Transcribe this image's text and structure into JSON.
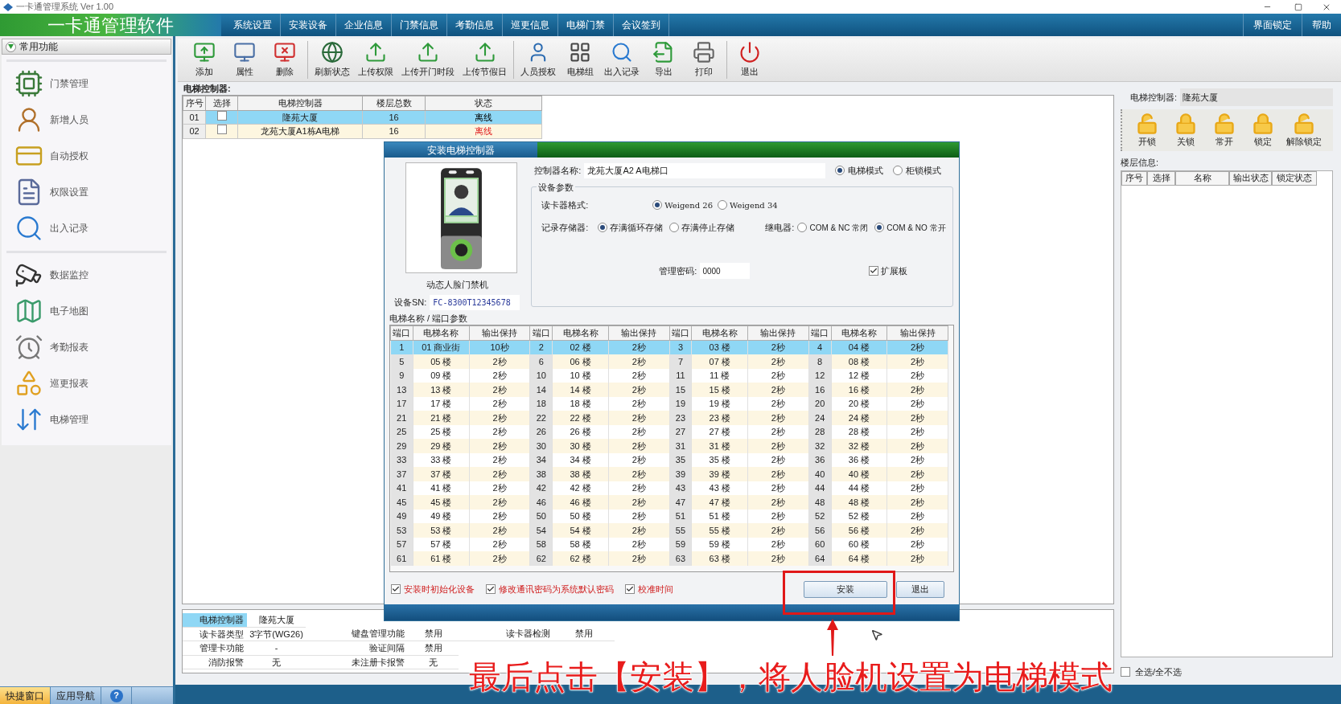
{
  "window": {
    "title": "一卡通管理系统 Ver 1.00"
  },
  "header": {
    "logo": "一卡通管理软件",
    "menu": [
      "系统设置",
      "安装设备",
      "企业信息",
      "门禁信息",
      "考勤信息",
      "巡更信息",
      "电梯门禁",
      "会议签到"
    ],
    "right_menu": [
      "界面锁定",
      "帮助"
    ]
  },
  "sidebar": {
    "title": "常用功能",
    "groups": [
      [
        "门禁管理",
        "新增人员",
        "自动授权",
        "权限设置",
        "出入记录"
      ],
      [
        "数据监控",
        "电子地图",
        "考勤报表",
        "巡更报表",
        "电梯管理"
      ]
    ]
  },
  "bottom_tabs": [
    {
      "label": "快捷窗口",
      "selected": true
    },
    {
      "label": "应用导航",
      "selected": false
    },
    {
      "label": "?",
      "selected": false
    }
  ],
  "toolbar": {
    "groups": [
      [
        "添加",
        "属性",
        "删除"
      ],
      [
        "刷新状态",
        "上传权限",
        "上传开门时段",
        "上传节假日"
      ],
      [
        "人员授权",
        "电梯组",
        "出入记录",
        "导出",
        "打印"
      ],
      [
        "退出"
      ]
    ]
  },
  "controllers": {
    "label": "电梯控制器:",
    "columns": [
      "序号",
      "选择",
      "电梯控制器",
      "楼层总数",
      "状态"
    ],
    "rows": [
      {
        "no": "01",
        "checked": false,
        "name": "隆苑大厦",
        "floors": "16",
        "status": "离线",
        "alert": false,
        "selected": true
      },
      {
        "no": "02",
        "checked": false,
        "name": "龙苑大厦A1栋A电梯",
        "floors": "16",
        "status": "离线",
        "alert": true,
        "selected": false
      }
    ]
  },
  "info_table": [
    [
      "电梯控制器",
      "隆苑大厦"
    ],
    [
      "读卡器类型",
      "3字节(WG26)",
      "键盘管理功能",
      "禁用",
      "读卡器检测",
      "禁用"
    ],
    [
      "管理卡功能",
      "-",
      "验证间隔",
      "禁用"
    ],
    [
      "消防报警",
      "无",
      "未注册卡报警",
      "无"
    ]
  ],
  "right_panel": {
    "controller_label": "电梯控制器:",
    "controller_value": "隆苑大厦",
    "actions": [
      {
        "label": "开锁",
        "kind": "open"
      },
      {
        "label": "关锁",
        "kind": "closed"
      },
      {
        "label": "常开",
        "kind": "open"
      },
      {
        "label": "锁定",
        "kind": "closed"
      },
      {
        "label": "解除锁定",
        "kind": "open"
      }
    ],
    "floor_label": "楼层信息:",
    "columns": [
      "序号",
      "选择",
      "名称",
      "输出状态",
      "锁定状态"
    ],
    "select_all": {
      "label": "全选/全不选",
      "checked": false
    }
  },
  "dialog": {
    "title": "安装电梯控制器",
    "device_name": "动态人脸门禁机",
    "sn_label": "设备SN:",
    "sn": "FC-8300T12345678",
    "name_label": "控制器名称:",
    "name_value": "龙苑大厦A2 A电梯口",
    "modes": [
      {
        "label": "电梯模式",
        "selected": true
      },
      {
        "label": "柜锁模式",
        "selected": false
      }
    ],
    "params_title": "设备参数",
    "reader_label": "读卡器格式:",
    "reader_options": [
      {
        "label": "Weigend 26",
        "selected": true
      },
      {
        "label": "Weigend 34",
        "selected": false
      }
    ],
    "storage_label": "记录存储器:",
    "storage_options": [
      {
        "label": "存满循环存储",
        "selected": true
      },
      {
        "label": "存满停止存储",
        "selected": false
      }
    ],
    "relay_label": "继电器:",
    "relay_options": [
      {
        "label": "COM & NC 常闭",
        "selected": false
      },
      {
        "label": "COM & NO 常开",
        "selected": true
      }
    ],
    "password_label": "管理密码:",
    "password": "0000",
    "expansion": {
      "label": "扩展板",
      "checked": true
    },
    "ports_title": "电梯名称 / 端口参数",
    "port_columns": [
      "端口",
      "电梯名称",
      "输出保持",
      "端口",
      "电梯名称",
      "输出保持",
      "端口",
      "电梯名称",
      "输出保持",
      "端口",
      "电梯名称",
      "输出保持"
    ],
    "port_rows": [
      {
        "selected": true,
        "cells": [
          {
            "port": "1",
            "name": "01 商业街",
            "hold": "10秒"
          },
          {
            "port": "2",
            "name": "02 楼",
            "hold": "2秒"
          },
          {
            "port": "3",
            "name": "03 楼",
            "hold": "2秒"
          },
          {
            "port": "4",
            "name": "04 楼",
            "hold": "2秒"
          }
        ]
      },
      {
        "selected": false,
        "cells": [
          {
            "port": "5",
            "name": "05 楼",
            "hold": "2秒"
          },
          {
            "port": "6",
            "name": "06 楼",
            "hold": "2秒"
          },
          {
            "port": "7",
            "name": "07 楼",
            "hold": "2秒"
          },
          {
            "port": "8",
            "name": "08 楼",
            "hold": "2秒"
          }
        ]
      },
      {
        "selected": false,
        "cells": [
          {
            "port": "9",
            "name": "09 楼",
            "hold": "2秒"
          },
          {
            "port": "10",
            "name": "10 楼",
            "hold": "2秒"
          },
          {
            "port": "11",
            "name": "11 楼",
            "hold": "2秒"
          },
          {
            "port": "12",
            "name": "12 楼",
            "hold": "2秒"
          }
        ]
      },
      {
        "selected": false,
        "cells": [
          {
            "port": "13",
            "name": "13 楼",
            "hold": "2秒"
          },
          {
            "port": "14",
            "name": "14 楼",
            "hold": "2秒"
          },
          {
            "port": "15",
            "name": "15 楼",
            "hold": "2秒"
          },
          {
            "port": "16",
            "name": "16 楼",
            "hold": "2秒"
          }
        ]
      },
      {
        "selected": false,
        "cells": [
          {
            "port": "17",
            "name": "17 楼",
            "hold": "2秒"
          },
          {
            "port": "18",
            "name": "18 楼",
            "hold": "2秒"
          },
          {
            "port": "19",
            "name": "19 楼",
            "hold": "2秒"
          },
          {
            "port": "20",
            "name": "20 楼",
            "hold": "2秒"
          }
        ]
      },
      {
        "selected": false,
        "cells": [
          {
            "port": "21",
            "name": "21 楼",
            "hold": "2秒"
          },
          {
            "port": "22",
            "name": "22 楼",
            "hold": "2秒"
          },
          {
            "port": "23",
            "name": "23 楼",
            "hold": "2秒"
          },
          {
            "port": "24",
            "name": "24 楼",
            "hold": "2秒"
          }
        ]
      },
      {
        "selected": false,
        "cells": [
          {
            "port": "25",
            "name": "25 楼",
            "hold": "2秒"
          },
          {
            "port": "26",
            "name": "26 楼",
            "hold": "2秒"
          },
          {
            "port": "27",
            "name": "27 楼",
            "hold": "2秒"
          },
          {
            "port": "28",
            "name": "28 楼",
            "hold": "2秒"
          }
        ]
      },
      {
        "selected": false,
        "cells": [
          {
            "port": "29",
            "name": "29 楼",
            "hold": "2秒"
          },
          {
            "port": "30",
            "name": "30 楼",
            "hold": "2秒"
          },
          {
            "port": "31",
            "name": "31 楼",
            "hold": "2秒"
          },
          {
            "port": "32",
            "name": "32 楼",
            "hold": "2秒"
          }
        ]
      },
      {
        "selected": false,
        "cells": [
          {
            "port": "33",
            "name": "33 楼",
            "hold": "2秒"
          },
          {
            "port": "34",
            "name": "34 楼",
            "hold": "2秒"
          },
          {
            "port": "35",
            "name": "35 楼",
            "hold": "2秒"
          },
          {
            "port": "36",
            "name": "36 楼",
            "hold": "2秒"
          }
        ]
      },
      {
        "selected": false,
        "cells": [
          {
            "port": "37",
            "name": "37 楼",
            "hold": "2秒"
          },
          {
            "port": "38",
            "name": "38 楼",
            "hold": "2秒"
          },
          {
            "port": "39",
            "name": "39 楼",
            "hold": "2秒"
          },
          {
            "port": "40",
            "name": "40 楼",
            "hold": "2秒"
          }
        ]
      },
      {
        "selected": false,
        "cells": [
          {
            "port": "41",
            "name": "41 楼",
            "hold": "2秒"
          },
          {
            "port": "42",
            "name": "42 楼",
            "hold": "2秒"
          },
          {
            "port": "43",
            "name": "43 楼",
            "hold": "2秒"
          },
          {
            "port": "44",
            "name": "44 楼",
            "hold": "2秒"
          }
        ]
      },
      {
        "selected": false,
        "cells": [
          {
            "port": "45",
            "name": "45 楼",
            "hold": "2秒"
          },
          {
            "port": "46",
            "name": "46 楼",
            "hold": "2秒"
          },
          {
            "port": "47",
            "name": "47 楼",
            "hold": "2秒"
          },
          {
            "port": "48",
            "name": "48 楼",
            "hold": "2秒"
          }
        ]
      },
      {
        "selected": false,
        "cells": [
          {
            "port": "49",
            "name": "49 楼",
            "hold": "2秒"
          },
          {
            "port": "50",
            "name": "50 楼",
            "hold": "2秒"
          },
          {
            "port": "51",
            "name": "51 楼",
            "hold": "2秒"
          },
          {
            "port": "52",
            "name": "52 楼",
            "hold": "2秒"
          }
        ]
      },
      {
        "selected": false,
        "cells": [
          {
            "port": "53",
            "name": "53 楼",
            "hold": "2秒"
          },
          {
            "port": "54",
            "name": "54 楼",
            "hold": "2秒"
          },
          {
            "port": "55",
            "name": "55 楼",
            "hold": "2秒"
          },
          {
            "port": "56",
            "name": "56 楼",
            "hold": "2秒"
          }
        ]
      },
      {
        "selected": false,
        "cells": [
          {
            "port": "57",
            "name": "57 楼",
            "hold": "2秒"
          },
          {
            "port": "58",
            "name": "58 楼",
            "hold": "2秒"
          },
          {
            "port": "59",
            "name": "59 楼",
            "hold": "2秒"
          },
          {
            "port": "60",
            "name": "60 楼",
            "hold": "2秒"
          }
        ]
      },
      {
        "selected": false,
        "cells": [
          {
            "port": "61",
            "name": "61 楼",
            "hold": "2秒"
          },
          {
            "port": "62",
            "name": "62 楼",
            "hold": "2秒"
          },
          {
            "port": "63",
            "name": "63 楼",
            "hold": "2秒"
          },
          {
            "port": "64",
            "name": "64 楼",
            "hold": "2秒"
          }
        ]
      }
    ],
    "options": [
      {
        "label": "安装时初始化设备",
        "checked": true
      },
      {
        "label": "修改通讯密码为系统默认密码",
        "checked": true
      },
      {
        "label": "校准时间",
        "checked": true
      }
    ],
    "buttons": [
      "安装",
      "退出"
    ]
  },
  "caption": "最后点击【安装】，将人脸机设置为电梯模式"
}
